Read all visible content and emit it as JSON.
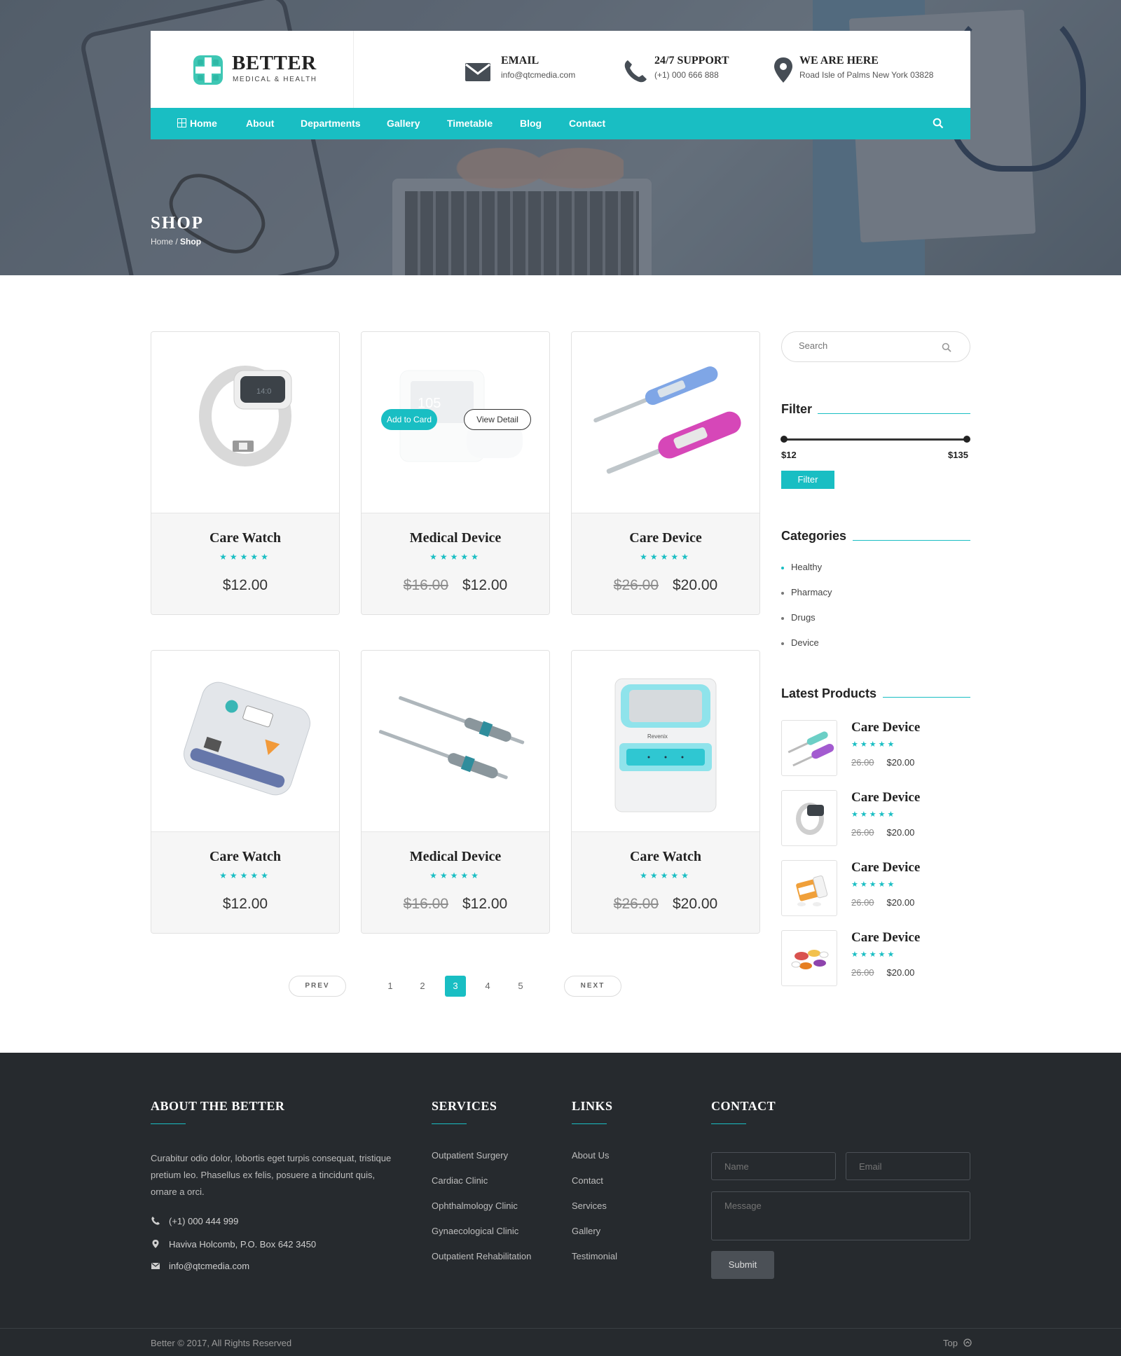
{
  "brand": {
    "name": "BETTER",
    "tagline": "MEDICAL & HEALTH"
  },
  "header_info": [
    {
      "icon": "envelope-icon",
      "title": "EMAIL",
      "subtitle": "info@qtcmedia.com"
    },
    {
      "icon": "phone-icon",
      "title": "24/7 SUPPORT",
      "subtitle": "(+1) 000 666 888"
    },
    {
      "icon": "map-pin-icon",
      "title": "WE ARE HERE",
      "subtitle": "Road Isle of Palms New York 03828"
    }
  ],
  "nav": {
    "items": [
      "Home",
      "About",
      "Departments",
      "Gallery",
      "Timetable",
      "Blog",
      "Contact"
    ],
    "home_icon": "grid-icon",
    "search_icon": "search-icon"
  },
  "page": {
    "title": "SHOP",
    "breadcrumb_home": "Home /",
    "breadcrumb_current": "Shop"
  },
  "products": [
    {
      "name": "Care Watch",
      "rating": 5,
      "old_price": "",
      "price": "$12.00",
      "image": "smart-watch"
    },
    {
      "name": "Medical Device",
      "rating": 5,
      "old_price": "$16.00",
      "price": "$12.00",
      "image": "medical-monitor",
      "hover": true
    },
    {
      "name": "Care Device",
      "rating": 5,
      "old_price": "$26.00",
      "price": "$20.00",
      "image": "thermometers"
    },
    {
      "name": "Care Watch",
      "rating": 5,
      "old_price": "",
      "price": "$12.00",
      "image": "defibrillator"
    },
    {
      "name": "Medical Device",
      "rating": 5,
      "old_price": "$16.00",
      "price": "$12.00",
      "image": "pens"
    },
    {
      "name": "Care Watch",
      "rating": 5,
      "old_price": "$26.00",
      "price": "$20.00",
      "image": "revenix-device"
    }
  ],
  "product_actions": {
    "add": "Add to Card",
    "view": "View Detail"
  },
  "pagination": {
    "prev": "PREV",
    "next": "NEXT",
    "pages": [
      "1",
      "2",
      "3",
      "4",
      "5"
    ],
    "current": "3"
  },
  "sidebar": {
    "search_placeholder": "Search",
    "filter": {
      "title": "Filter",
      "min": "$12",
      "max": "$135",
      "button": "Filter"
    },
    "categories": {
      "title": "Categories",
      "items": [
        "Healthy",
        "Pharmacy",
        "Drugs",
        "Device"
      ]
    },
    "latest": {
      "title": "Latest Products",
      "items": [
        {
          "name": "Care Device",
          "old_price": "26.00",
          "price": "$20.00",
          "image": "thermometers"
        },
        {
          "name": "Care Device",
          "old_price": "26.00",
          "price": "$20.00",
          "image": "smart-watch"
        },
        {
          "name": "Care Device",
          "old_price": "26.00",
          "price": "$20.00",
          "image": "pill-bottle"
        },
        {
          "name": "Care Device",
          "old_price": "26.00",
          "price": "$20.00",
          "image": "pills"
        }
      ]
    }
  },
  "footer": {
    "about": {
      "title": "ABOUT THE BETTER",
      "text": "Curabitur odio dolor, lobortis eget turpis consequat, tristique pretium leo. Phasellus ex felis, posuere a tincidunt quis, ornare a orci.",
      "phone": "(+1) 000 444 999",
      "address": "Haviva Holcomb, P.O. Box 642 3450",
      "email": "info@qtcmedia.com"
    },
    "services": {
      "title": "SERVICES",
      "items": [
        "Outpatient Surgery",
        "Cardiac Clinic",
        "Ophthalmology Clinic",
        "Gynaecological Clinic",
        "Outpatient Rehabilitation"
      ]
    },
    "links": {
      "title": "LINKS",
      "items": [
        "About Us",
        "Contact",
        "Services",
        "Gallery",
        "Testimonial"
      ]
    },
    "contact": {
      "title": "CONTACT",
      "name_placeholder": "Name",
      "email_placeholder": "Email",
      "message_placeholder": "Message",
      "submit": "Submit"
    },
    "copyright": "Better © 2017, All Rights Reserved",
    "top": "Top"
  },
  "colors": {
    "accent": "#19bec3",
    "dark": "#262a2e"
  }
}
